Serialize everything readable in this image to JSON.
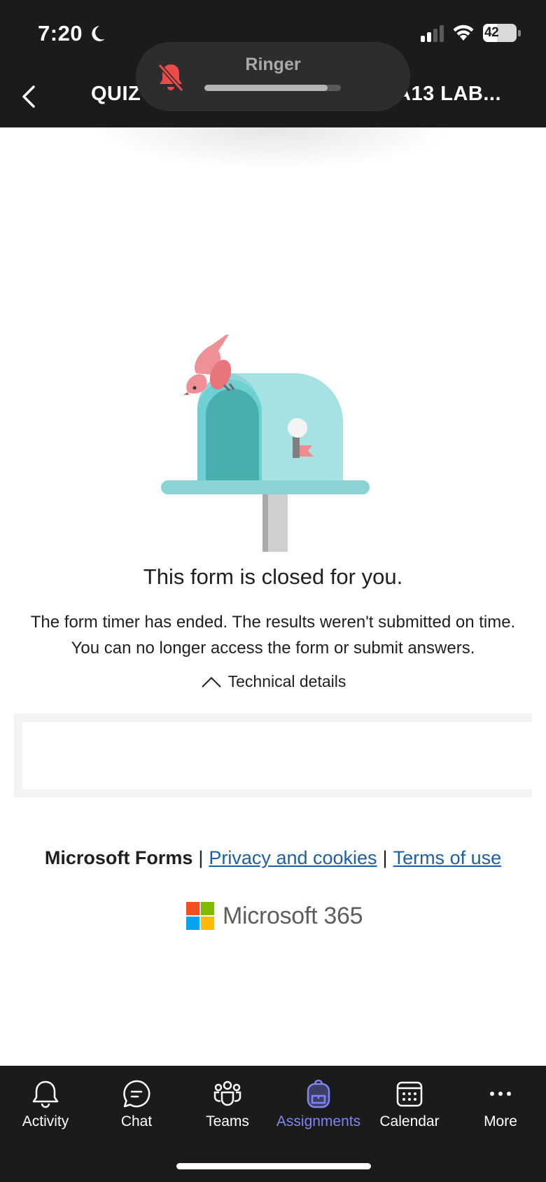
{
  "status_bar": {
    "time": "7:20",
    "battery": "42"
  },
  "nav": {
    "title_left": "QUIZ",
    "title_right": "A13 LAB..."
  },
  "ringer": {
    "label": "Ringer",
    "level": 0.9
  },
  "form": {
    "title": "This form is closed for you.",
    "description": "The form timer has ended. The results weren't submitted on time. You can no longer access the form or submit answers.",
    "technical_details_label": "Technical details"
  },
  "footer": {
    "brand": "Microsoft Forms",
    "separator": "|",
    "privacy_label": "Privacy and cookies",
    "terms_label": "Terms of use",
    "logo_text": "Microsoft 365"
  },
  "colors": {
    "accent": "#7f85f5",
    "link": "#1a5fa8",
    "ms_red": "#f25022",
    "ms_green": "#7fba00",
    "ms_blue": "#00a4ef",
    "ms_yellow": "#ffb900"
  },
  "tabs": [
    {
      "label": "Activity",
      "icon": "bell-icon"
    },
    {
      "label": "Chat",
      "icon": "chat-icon"
    },
    {
      "label": "Teams",
      "icon": "teams-icon"
    },
    {
      "label": "Assignments",
      "icon": "backpack-icon",
      "active": true
    },
    {
      "label": "Calendar",
      "icon": "calendar-icon"
    },
    {
      "label": "More",
      "icon": "more-icon"
    }
  ]
}
